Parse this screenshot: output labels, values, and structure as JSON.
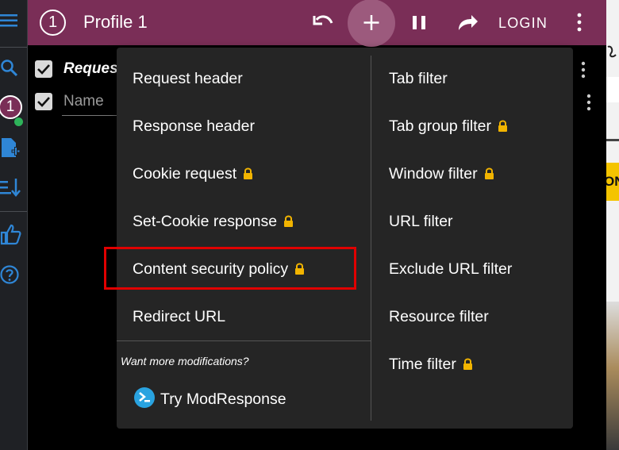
{
  "topbar": {
    "profile_number": "1",
    "profile_name": "Profile 1",
    "login_label": "LOGIN"
  },
  "rail": {
    "profile_badge": "1"
  },
  "background": {
    "header_row_label": "Reques",
    "name_placeholder": "Name",
    "right_partial_text": "ON"
  },
  "menu": {
    "left_items": [
      {
        "label": "Request header",
        "locked": false
      },
      {
        "label": "Response header",
        "locked": false
      },
      {
        "label": "Cookie request",
        "locked": true
      },
      {
        "label": "Set-Cookie response",
        "locked": true
      },
      {
        "label": "Content security policy",
        "locked": true
      },
      {
        "label": "Redirect URL",
        "locked": false
      }
    ],
    "right_items": [
      {
        "label": "Tab filter",
        "locked": false
      },
      {
        "label": "Tab group filter",
        "locked": true
      },
      {
        "label": "Window filter",
        "locked": true
      },
      {
        "label": "URL filter",
        "locked": false
      },
      {
        "label": "Exclude URL filter",
        "locked": false
      },
      {
        "label": "Resource filter",
        "locked": false
      },
      {
        "label": "Time filter",
        "locked": true
      }
    ],
    "more_hint": "Want more modifications?",
    "try_label": "Try ModResponse"
  },
  "colors": {
    "topbar": "#7a2e57",
    "lock": "#f2b400",
    "highlight": "#e00000",
    "rail_icon": "#2f86d6"
  }
}
